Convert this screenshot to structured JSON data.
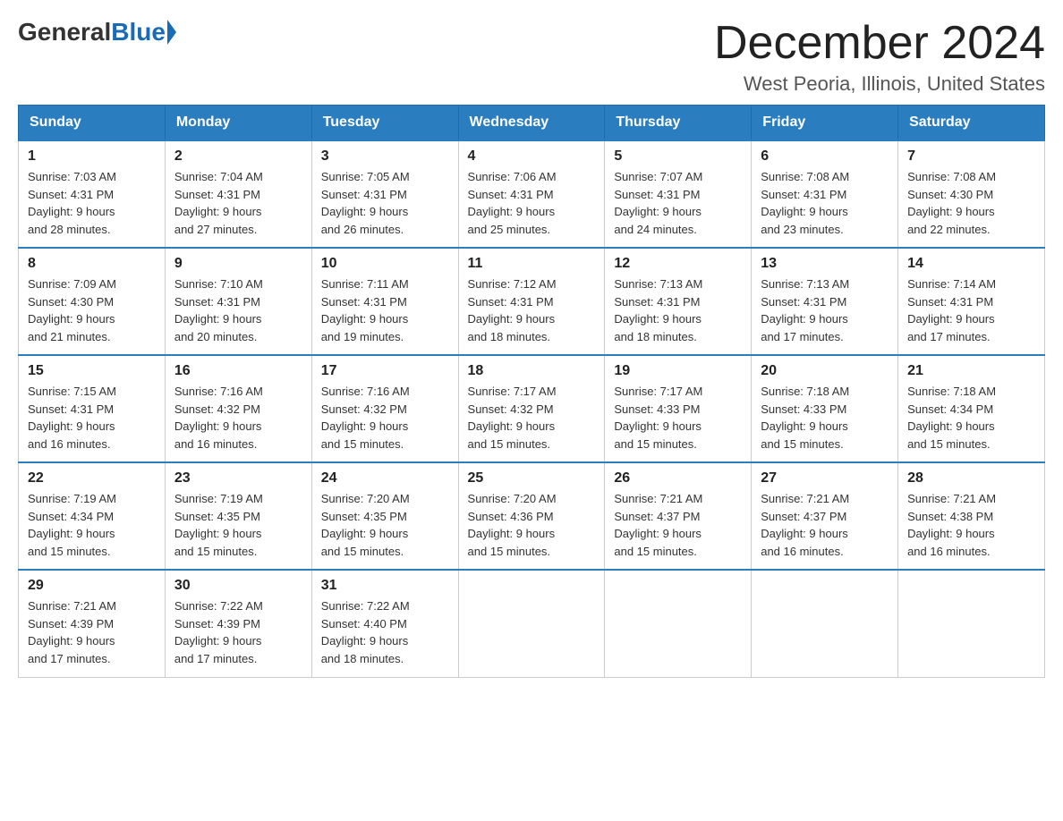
{
  "logo": {
    "general": "General",
    "blue": "Blue"
  },
  "header": {
    "month": "December 2024",
    "location": "West Peoria, Illinois, United States"
  },
  "weekdays": [
    "Sunday",
    "Monday",
    "Tuesday",
    "Wednesday",
    "Thursday",
    "Friday",
    "Saturday"
  ],
  "weeks": [
    [
      {
        "day": "1",
        "sunrise": "7:03 AM",
        "sunset": "4:31 PM",
        "daylight": "9 hours and 28 minutes."
      },
      {
        "day": "2",
        "sunrise": "7:04 AM",
        "sunset": "4:31 PM",
        "daylight": "9 hours and 27 minutes."
      },
      {
        "day": "3",
        "sunrise": "7:05 AM",
        "sunset": "4:31 PM",
        "daylight": "9 hours and 26 minutes."
      },
      {
        "day": "4",
        "sunrise": "7:06 AM",
        "sunset": "4:31 PM",
        "daylight": "9 hours and 25 minutes."
      },
      {
        "day": "5",
        "sunrise": "7:07 AM",
        "sunset": "4:31 PM",
        "daylight": "9 hours and 24 minutes."
      },
      {
        "day": "6",
        "sunrise": "7:08 AM",
        "sunset": "4:31 PM",
        "daylight": "9 hours and 23 minutes."
      },
      {
        "day": "7",
        "sunrise": "7:08 AM",
        "sunset": "4:30 PM",
        "daylight": "9 hours and 22 minutes."
      }
    ],
    [
      {
        "day": "8",
        "sunrise": "7:09 AM",
        "sunset": "4:30 PM",
        "daylight": "9 hours and 21 minutes."
      },
      {
        "day": "9",
        "sunrise": "7:10 AM",
        "sunset": "4:31 PM",
        "daylight": "9 hours and 20 minutes."
      },
      {
        "day": "10",
        "sunrise": "7:11 AM",
        "sunset": "4:31 PM",
        "daylight": "9 hours and 19 minutes."
      },
      {
        "day": "11",
        "sunrise": "7:12 AM",
        "sunset": "4:31 PM",
        "daylight": "9 hours and 18 minutes."
      },
      {
        "day": "12",
        "sunrise": "7:13 AM",
        "sunset": "4:31 PM",
        "daylight": "9 hours and 18 minutes."
      },
      {
        "day": "13",
        "sunrise": "7:13 AM",
        "sunset": "4:31 PM",
        "daylight": "9 hours and 17 minutes."
      },
      {
        "day": "14",
        "sunrise": "7:14 AM",
        "sunset": "4:31 PM",
        "daylight": "9 hours and 17 minutes."
      }
    ],
    [
      {
        "day": "15",
        "sunrise": "7:15 AM",
        "sunset": "4:31 PM",
        "daylight": "9 hours and 16 minutes."
      },
      {
        "day": "16",
        "sunrise": "7:16 AM",
        "sunset": "4:32 PM",
        "daylight": "9 hours and 16 minutes."
      },
      {
        "day": "17",
        "sunrise": "7:16 AM",
        "sunset": "4:32 PM",
        "daylight": "9 hours and 15 minutes."
      },
      {
        "day": "18",
        "sunrise": "7:17 AM",
        "sunset": "4:32 PM",
        "daylight": "9 hours and 15 minutes."
      },
      {
        "day": "19",
        "sunrise": "7:17 AM",
        "sunset": "4:33 PM",
        "daylight": "9 hours and 15 minutes."
      },
      {
        "day": "20",
        "sunrise": "7:18 AM",
        "sunset": "4:33 PM",
        "daylight": "9 hours and 15 minutes."
      },
      {
        "day": "21",
        "sunrise": "7:18 AM",
        "sunset": "4:34 PM",
        "daylight": "9 hours and 15 minutes."
      }
    ],
    [
      {
        "day": "22",
        "sunrise": "7:19 AM",
        "sunset": "4:34 PM",
        "daylight": "9 hours and 15 minutes."
      },
      {
        "day": "23",
        "sunrise": "7:19 AM",
        "sunset": "4:35 PM",
        "daylight": "9 hours and 15 minutes."
      },
      {
        "day": "24",
        "sunrise": "7:20 AM",
        "sunset": "4:35 PM",
        "daylight": "9 hours and 15 minutes."
      },
      {
        "day": "25",
        "sunrise": "7:20 AM",
        "sunset": "4:36 PM",
        "daylight": "9 hours and 15 minutes."
      },
      {
        "day": "26",
        "sunrise": "7:21 AM",
        "sunset": "4:37 PM",
        "daylight": "9 hours and 15 minutes."
      },
      {
        "day": "27",
        "sunrise": "7:21 AM",
        "sunset": "4:37 PM",
        "daylight": "9 hours and 16 minutes."
      },
      {
        "day": "28",
        "sunrise": "7:21 AM",
        "sunset": "4:38 PM",
        "daylight": "9 hours and 16 minutes."
      }
    ],
    [
      {
        "day": "29",
        "sunrise": "7:21 AM",
        "sunset": "4:39 PM",
        "daylight": "9 hours and 17 minutes."
      },
      {
        "day": "30",
        "sunrise": "7:22 AM",
        "sunset": "4:39 PM",
        "daylight": "9 hours and 17 minutes."
      },
      {
        "day": "31",
        "sunrise": "7:22 AM",
        "sunset": "4:40 PM",
        "daylight": "9 hours and 18 minutes."
      },
      null,
      null,
      null,
      null
    ]
  ],
  "labels": {
    "sunrise": "Sunrise:",
    "sunset": "Sunset:",
    "daylight": "Daylight:"
  }
}
